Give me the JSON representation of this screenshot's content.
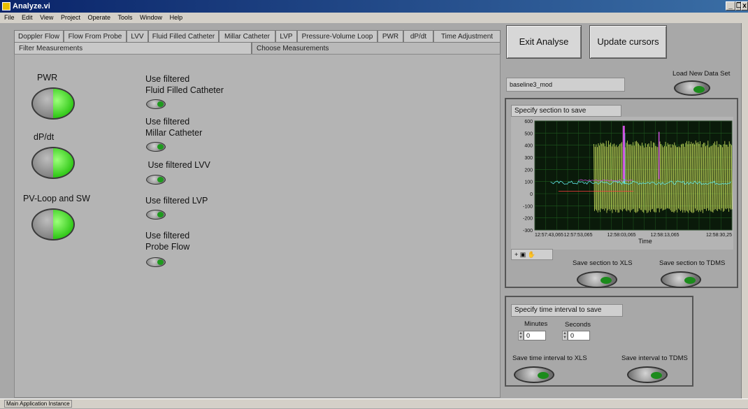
{
  "window": {
    "title": "Analyze.vi",
    "min": "_",
    "max": "❐",
    "close": "x"
  },
  "menu": [
    "File",
    "Edit",
    "View",
    "Project",
    "Operate",
    "Tools",
    "Window",
    "Help"
  ],
  "tabs": [
    "Doppler Flow",
    "Flow From Probe",
    "LVV",
    "Fluid Filled Catheter",
    "Millar Catheter",
    "LVP",
    "Pressure-Volume Loop",
    "PWR",
    "dP/dt",
    "Time Adjustment"
  ],
  "subtabs": {
    "filter": "Filter Measurements",
    "choose": "Choose Measurements"
  },
  "measurements": [
    {
      "label": "PWR"
    },
    {
      "label": "dP/dt"
    },
    {
      "label": "PV-Loop and SW"
    }
  ],
  "filters": [
    {
      "line1": "Use filtered",
      "line2": "Fluid Filled Catheter"
    },
    {
      "line1": "Use filtered",
      "line2": "Millar Catheter"
    },
    {
      "line1": " Use filtered LVV",
      "line2": ""
    },
    {
      "line1": "Use filtered LVP",
      "line2": ""
    },
    {
      "line1": "Use filtered",
      "line2": "Probe Flow"
    }
  ],
  "buttons": {
    "exit": "Exit Analyse",
    "update": "Update cursors"
  },
  "dataset": {
    "filename": "baseline3_mod",
    "load_label": "Load New Data Set"
  },
  "section": {
    "title": "Specify section to save",
    "save_xls": "Save section to XLS",
    "save_tdms": "Save section to TDMS",
    "palette": "+ ▣ ✋"
  },
  "interval": {
    "title": "Specify time interval to save",
    "minutes_label": "Minutes",
    "seconds_label": "Seconds",
    "minutes": "0",
    "seconds": "0",
    "save_xls": "Save time interval to XLS",
    "save_tdms": "Save interval to TDMS"
  },
  "status": {
    "instance": "Main Application Instance"
  },
  "chart_data": {
    "type": "line",
    "title": "",
    "xlabel": "Time",
    "ylabel": "",
    "ylim": [
      -300,
      600
    ],
    "yticks": [
      600,
      500,
      400,
      300,
      200,
      100,
      0,
      -100,
      -200,
      -300
    ],
    "xticks": [
      "12:57:43,065",
      "12:57:53,065",
      "12:58:03,065",
      "12:58:13,065",
      "12:58:30,25"
    ],
    "grid": true,
    "colors": {
      "bg": "#0a1a0a",
      "grid": "#1f5a1f",
      "yellow": "#e8ff6a",
      "cyan": "#5fe6e6",
      "magenta": "#d050e0",
      "red": "#ff4040"
    },
    "series": [
      {
        "color": "yellow",
        "values": "oscillating signal approx -150 to 420 after t≈12:57:53"
      },
      {
        "color": "cyan",
        "values": "baseline near 90, spike to ~500 at t≈12:58:03"
      },
      {
        "color": "magenta",
        "values": "baseline near 110, spikes to ~560 at t≈12:58:03 and ~510 at t≈12:58:08"
      },
      {
        "color": "red",
        "values": "near 20"
      }
    ]
  }
}
